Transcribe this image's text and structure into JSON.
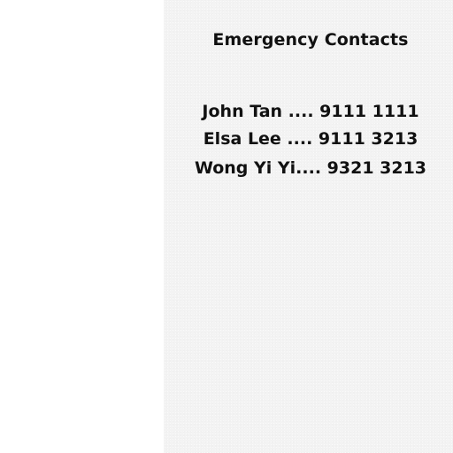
{
  "note": {
    "title": "Emergency Contacts",
    "contacts": [
      "John Tan .... 9111 1111",
      "Elsa Lee .... 9111 3213",
      "Wong Yi Yi.... 9321 3213"
    ]
  },
  "colors": {
    "panel_background": "#f3f3f3",
    "text": "#111111",
    "left_area": "#ffffff"
  }
}
